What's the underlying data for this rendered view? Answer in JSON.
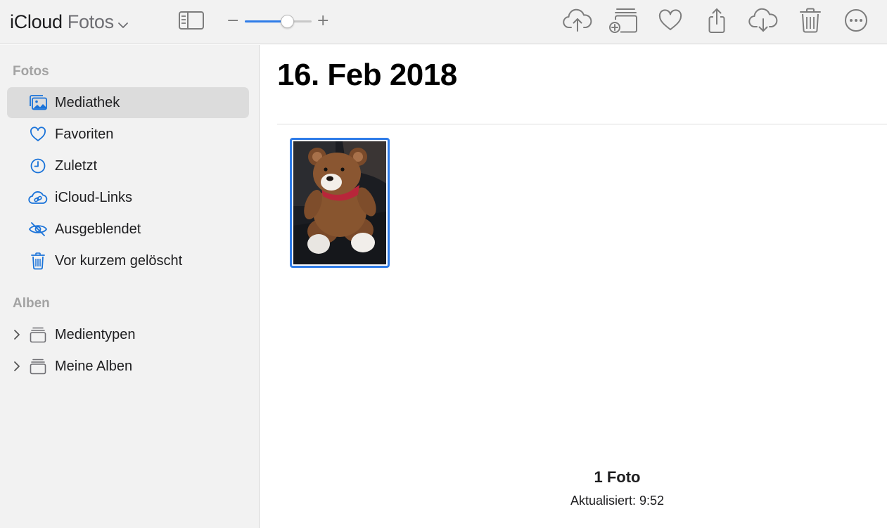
{
  "header": {
    "brand": "iCloud",
    "app_name": "Fotos",
    "zoom_level_percent": 64,
    "toolbar_actions": [
      {
        "name": "upload",
        "icon": "cloud-upload-icon"
      },
      {
        "name": "add-to-album",
        "icon": "add-to-album-icon"
      },
      {
        "name": "favorite",
        "icon": "heart-icon"
      },
      {
        "name": "share",
        "icon": "share-icon"
      },
      {
        "name": "download",
        "icon": "cloud-download-icon"
      },
      {
        "name": "delete",
        "icon": "trash-icon"
      },
      {
        "name": "more",
        "icon": "more-icon"
      }
    ]
  },
  "sidebar": {
    "fotos_heading": "Fotos",
    "items": [
      {
        "label": "Mediathek",
        "icon": "library-icon",
        "selected": true
      },
      {
        "label": "Favoriten",
        "icon": "heart-icon"
      },
      {
        "label": "Zuletzt",
        "icon": "clock-icon"
      },
      {
        "label": "iCloud-Links",
        "icon": "cloud-link-icon"
      },
      {
        "label": "Ausgeblendet",
        "icon": "eye-slash-icon"
      },
      {
        "label": "Vor kurzem gelöscht",
        "icon": "trash-icon"
      }
    ],
    "alben_heading": "Alben",
    "albums": [
      {
        "label": "Medientypen",
        "icon": "album-stack-icon"
      },
      {
        "label": "Meine Alben",
        "icon": "album-stack-icon"
      }
    ]
  },
  "main": {
    "date_heading": "16. Feb 2018",
    "photo_count": "1 Foto",
    "updated": "Aktualisiert: 9:52"
  },
  "colors": {
    "accent": "#2f7ce8",
    "sidebar_icon": "#1a73d9",
    "toolbar_icon": "#7d7d7d",
    "sidebar_bg": "#f2f2f2",
    "selected_bg": "#dcdcdc"
  }
}
